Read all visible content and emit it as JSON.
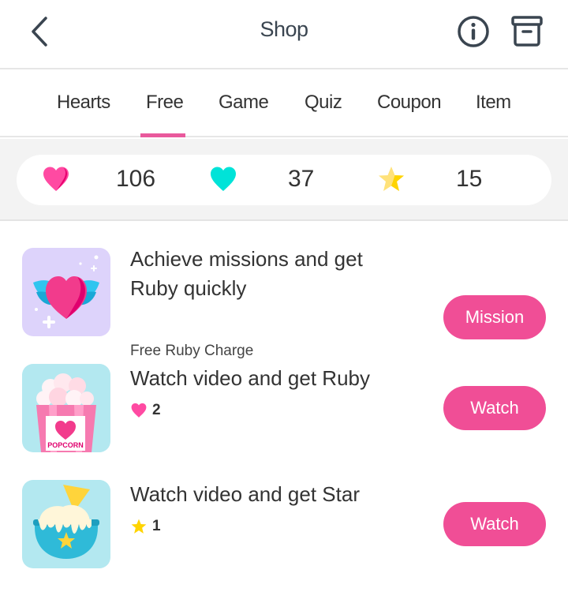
{
  "header": {
    "title": "Shop",
    "back_icon": "chevron-left-icon",
    "info_icon": "info-icon",
    "storage_icon": "archive-box-icon"
  },
  "tabs": [
    {
      "label": "Hearts",
      "active": false
    },
    {
      "label": "Free",
      "active": true
    },
    {
      "label": "Game",
      "active": false
    },
    {
      "label": "Quiz",
      "active": false
    },
    {
      "label": "Coupon",
      "active": false
    },
    {
      "label": "Item",
      "active": false
    }
  ],
  "balances": [
    {
      "icon": "pink-heart-icon",
      "value": "106"
    },
    {
      "icon": "teal-heart-icon",
      "value": "37"
    },
    {
      "icon": "star-icon",
      "value": "15"
    }
  ],
  "items": [
    {
      "title": "Achieve missions and get Ruby quickly",
      "subtitle": "Free Ruby Charge",
      "thumb_icon": "winged-heart-icon",
      "button": "Mission"
    },
    {
      "title": "Watch video and get Ruby",
      "reward_icon": "pink-heart-icon",
      "reward_value": "2",
      "thumb_icon": "popcorn-icon",
      "thumb_text": "POPCORN",
      "button": "Watch"
    },
    {
      "title": "Watch video and get Star",
      "reward_icon": "star-icon",
      "reward_value": "1",
      "thumb_icon": "ice-cream-bowl-icon",
      "button": "Watch"
    }
  ],
  "colors": {
    "accent": "#f04e96",
    "tab_indicator": "#e9599c",
    "heart_pink": "#ff4aa2",
    "heart_teal": "#00e3d8",
    "star_yellow": "#ffd43b"
  }
}
